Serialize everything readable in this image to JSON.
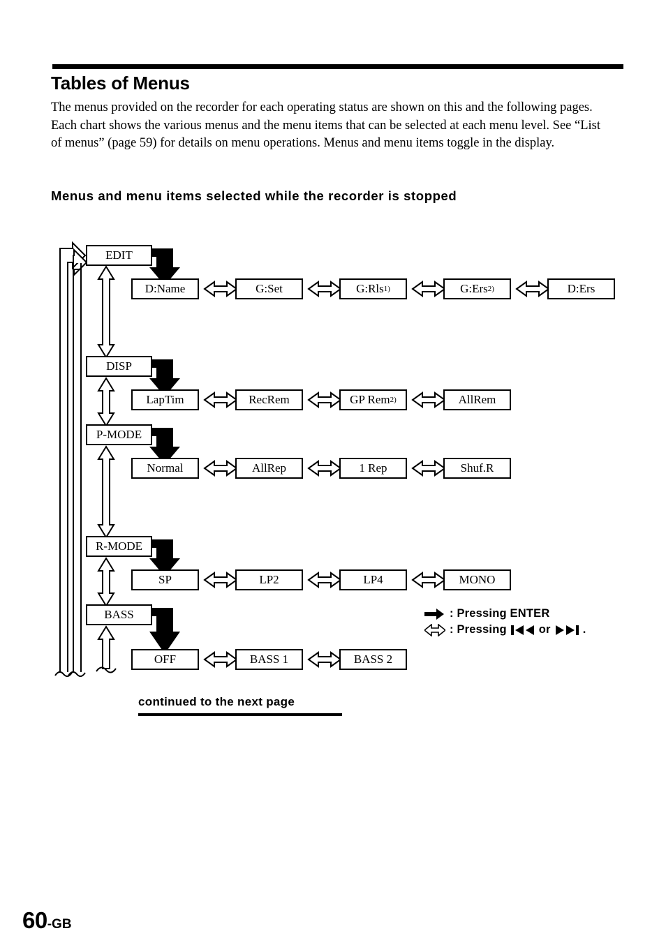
{
  "header": {
    "title": "Tables of Menus",
    "intro": "The menus provided on the recorder for each operating status are shown on this and the following pages. Each chart shows the various menus and the menu items that can be selected at each menu level. See “List of menus” (page 59) for details on menu operations. Menus and menu items toggle in the display.",
    "subhead": "Menus and menu items selected while the recorder is stopped"
  },
  "chart_data": {
    "type": "diagram",
    "title": "Menus and menu items selected while the recorder is stopped",
    "rows": [
      {
        "menu": "EDIT",
        "items": [
          {
            "label": "D:Name",
            "note": ""
          },
          {
            "label": "G:Set",
            "note": ""
          },
          {
            "label": "G:Rls",
            "note": "1)"
          },
          {
            "label": "G:Ers",
            "note": "2)"
          },
          {
            "label": "D:Ers",
            "note": ""
          }
        ]
      },
      {
        "menu": "DISP",
        "items": [
          {
            "label": "LapTim",
            "note": ""
          },
          {
            "label": "RecRem",
            "note": ""
          },
          {
            "label": "GP Rem",
            "note": "2)"
          },
          {
            "label": "AllRem",
            "note": ""
          }
        ]
      },
      {
        "menu": "P-MODE",
        "items": [
          {
            "label": "Normal",
            "note": ""
          },
          {
            "label": "AllRep",
            "note": ""
          },
          {
            "label": "1 Rep",
            "note": ""
          },
          {
            "label": "Shuf.R",
            "note": ""
          }
        ]
      },
      {
        "menu": "R-MODE",
        "items": [
          {
            "label": "SP",
            "note": ""
          },
          {
            "label": "LP2",
            "note": ""
          },
          {
            "label": "LP4",
            "note": ""
          },
          {
            "label": "MONO",
            "note": ""
          }
        ]
      },
      {
        "menu": "BASS",
        "items": [
          {
            "label": "OFF",
            "note": ""
          },
          {
            "label": "BASS 1",
            "note": ""
          },
          {
            "label": "BASS 2",
            "note": ""
          }
        ]
      }
    ],
    "legend": [
      {
        "glyph": "solid-right-arrow-icon",
        "text": ": Pressing ENTER"
      },
      {
        "glyph": "hollow-double-arrow-icon",
        "text": ": Pressing",
        "text_after": "or",
        "text_end": "."
      }
    ]
  },
  "footer": {
    "continued": "continued to the next page",
    "page_number": "60",
    "page_suffix": "-GB"
  }
}
